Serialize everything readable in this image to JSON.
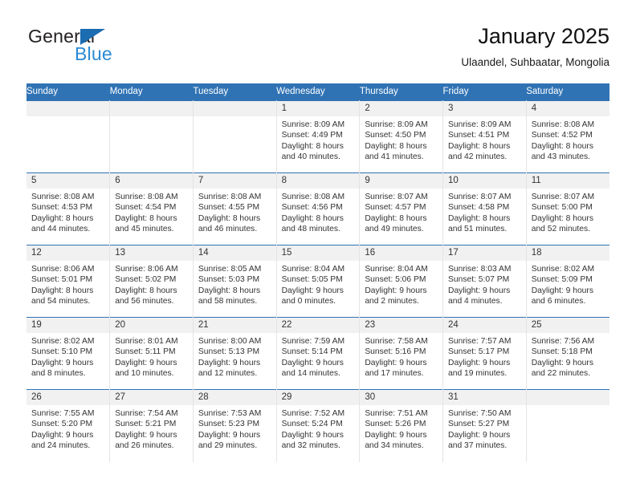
{
  "brand": {
    "name_top": "General",
    "name_bottom": "Blue",
    "flag_icon": "triangle-flag-icon",
    "colors": {
      "dark": "#231f20",
      "blue": "#2a8ad4",
      "flag": "#1b6cb0"
    }
  },
  "header": {
    "title": "January 2025",
    "subtitle": "Ulaandel, Suhbaatar, Mongolia"
  },
  "calendar": {
    "accent_color": "#3073b4",
    "daynum_band_color": "#f1f1f1",
    "weekdays": [
      "Sunday",
      "Monday",
      "Tuesday",
      "Wednesday",
      "Thursday",
      "Friday",
      "Saturday"
    ],
    "weeks": [
      [
        {
          "day": "",
          "empty": true,
          "sunrise": "",
          "sunset": "",
          "daylight1": "",
          "daylight2": ""
        },
        {
          "day": "",
          "empty": true,
          "sunrise": "",
          "sunset": "",
          "daylight1": "",
          "daylight2": ""
        },
        {
          "day": "",
          "empty": true,
          "sunrise": "",
          "sunset": "",
          "daylight1": "",
          "daylight2": ""
        },
        {
          "day": "1",
          "sunrise": "Sunrise: 8:09 AM",
          "sunset": "Sunset: 4:49 PM",
          "daylight1": "Daylight: 8 hours",
          "daylight2": "and 40 minutes."
        },
        {
          "day": "2",
          "sunrise": "Sunrise: 8:09 AM",
          "sunset": "Sunset: 4:50 PM",
          "daylight1": "Daylight: 8 hours",
          "daylight2": "and 41 minutes."
        },
        {
          "day": "3",
          "sunrise": "Sunrise: 8:09 AM",
          "sunset": "Sunset: 4:51 PM",
          "daylight1": "Daylight: 8 hours",
          "daylight2": "and 42 minutes."
        },
        {
          "day": "4",
          "sunrise": "Sunrise: 8:08 AM",
          "sunset": "Sunset: 4:52 PM",
          "daylight1": "Daylight: 8 hours",
          "daylight2": "and 43 minutes."
        }
      ],
      [
        {
          "day": "5",
          "sunrise": "Sunrise: 8:08 AM",
          "sunset": "Sunset: 4:53 PM",
          "daylight1": "Daylight: 8 hours",
          "daylight2": "and 44 minutes."
        },
        {
          "day": "6",
          "sunrise": "Sunrise: 8:08 AM",
          "sunset": "Sunset: 4:54 PM",
          "daylight1": "Daylight: 8 hours",
          "daylight2": "and 45 minutes."
        },
        {
          "day": "7",
          "sunrise": "Sunrise: 8:08 AM",
          "sunset": "Sunset: 4:55 PM",
          "daylight1": "Daylight: 8 hours",
          "daylight2": "and 46 minutes."
        },
        {
          "day": "8",
          "sunrise": "Sunrise: 8:08 AM",
          "sunset": "Sunset: 4:56 PM",
          "daylight1": "Daylight: 8 hours",
          "daylight2": "and 48 minutes."
        },
        {
          "day": "9",
          "sunrise": "Sunrise: 8:07 AM",
          "sunset": "Sunset: 4:57 PM",
          "daylight1": "Daylight: 8 hours",
          "daylight2": "and 49 minutes."
        },
        {
          "day": "10",
          "sunrise": "Sunrise: 8:07 AM",
          "sunset": "Sunset: 4:58 PM",
          "daylight1": "Daylight: 8 hours",
          "daylight2": "and 51 minutes."
        },
        {
          "day": "11",
          "sunrise": "Sunrise: 8:07 AM",
          "sunset": "Sunset: 5:00 PM",
          "daylight1": "Daylight: 8 hours",
          "daylight2": "and 52 minutes."
        }
      ],
      [
        {
          "day": "12",
          "sunrise": "Sunrise: 8:06 AM",
          "sunset": "Sunset: 5:01 PM",
          "daylight1": "Daylight: 8 hours",
          "daylight2": "and 54 minutes."
        },
        {
          "day": "13",
          "sunrise": "Sunrise: 8:06 AM",
          "sunset": "Sunset: 5:02 PM",
          "daylight1": "Daylight: 8 hours",
          "daylight2": "and 56 minutes."
        },
        {
          "day": "14",
          "sunrise": "Sunrise: 8:05 AM",
          "sunset": "Sunset: 5:03 PM",
          "daylight1": "Daylight: 8 hours",
          "daylight2": "and 58 minutes."
        },
        {
          "day": "15",
          "sunrise": "Sunrise: 8:04 AM",
          "sunset": "Sunset: 5:05 PM",
          "daylight1": "Daylight: 9 hours",
          "daylight2": "and 0 minutes."
        },
        {
          "day": "16",
          "sunrise": "Sunrise: 8:04 AM",
          "sunset": "Sunset: 5:06 PM",
          "daylight1": "Daylight: 9 hours",
          "daylight2": "and 2 minutes."
        },
        {
          "day": "17",
          "sunrise": "Sunrise: 8:03 AM",
          "sunset": "Sunset: 5:07 PM",
          "daylight1": "Daylight: 9 hours",
          "daylight2": "and 4 minutes."
        },
        {
          "day": "18",
          "sunrise": "Sunrise: 8:02 AM",
          "sunset": "Sunset: 5:09 PM",
          "daylight1": "Daylight: 9 hours",
          "daylight2": "and 6 minutes."
        }
      ],
      [
        {
          "day": "19",
          "sunrise": "Sunrise: 8:02 AM",
          "sunset": "Sunset: 5:10 PM",
          "daylight1": "Daylight: 9 hours",
          "daylight2": "and 8 minutes."
        },
        {
          "day": "20",
          "sunrise": "Sunrise: 8:01 AM",
          "sunset": "Sunset: 5:11 PM",
          "daylight1": "Daylight: 9 hours",
          "daylight2": "and 10 minutes."
        },
        {
          "day": "21",
          "sunrise": "Sunrise: 8:00 AM",
          "sunset": "Sunset: 5:13 PM",
          "daylight1": "Daylight: 9 hours",
          "daylight2": "and 12 minutes."
        },
        {
          "day": "22",
          "sunrise": "Sunrise: 7:59 AM",
          "sunset": "Sunset: 5:14 PM",
          "daylight1": "Daylight: 9 hours",
          "daylight2": "and 14 minutes."
        },
        {
          "day": "23",
          "sunrise": "Sunrise: 7:58 AM",
          "sunset": "Sunset: 5:16 PM",
          "daylight1": "Daylight: 9 hours",
          "daylight2": "and 17 minutes."
        },
        {
          "day": "24",
          "sunrise": "Sunrise: 7:57 AM",
          "sunset": "Sunset: 5:17 PM",
          "daylight1": "Daylight: 9 hours",
          "daylight2": "and 19 minutes."
        },
        {
          "day": "25",
          "sunrise": "Sunrise: 7:56 AM",
          "sunset": "Sunset: 5:18 PM",
          "daylight1": "Daylight: 9 hours",
          "daylight2": "and 22 minutes."
        }
      ],
      [
        {
          "day": "26",
          "sunrise": "Sunrise: 7:55 AM",
          "sunset": "Sunset: 5:20 PM",
          "daylight1": "Daylight: 9 hours",
          "daylight2": "and 24 minutes."
        },
        {
          "day": "27",
          "sunrise": "Sunrise: 7:54 AM",
          "sunset": "Sunset: 5:21 PM",
          "daylight1": "Daylight: 9 hours",
          "daylight2": "and 26 minutes."
        },
        {
          "day": "28",
          "sunrise": "Sunrise: 7:53 AM",
          "sunset": "Sunset: 5:23 PM",
          "daylight1": "Daylight: 9 hours",
          "daylight2": "and 29 minutes."
        },
        {
          "day": "29",
          "sunrise": "Sunrise: 7:52 AM",
          "sunset": "Sunset: 5:24 PM",
          "daylight1": "Daylight: 9 hours",
          "daylight2": "and 32 minutes."
        },
        {
          "day": "30",
          "sunrise": "Sunrise: 7:51 AM",
          "sunset": "Sunset: 5:26 PM",
          "daylight1": "Daylight: 9 hours",
          "daylight2": "and 34 minutes."
        },
        {
          "day": "31",
          "sunrise": "Sunrise: 7:50 AM",
          "sunset": "Sunset: 5:27 PM",
          "daylight1": "Daylight: 9 hours",
          "daylight2": "and 37 minutes."
        },
        {
          "day": "",
          "empty": true,
          "sunrise": "",
          "sunset": "",
          "daylight1": "",
          "daylight2": ""
        }
      ]
    ]
  }
}
